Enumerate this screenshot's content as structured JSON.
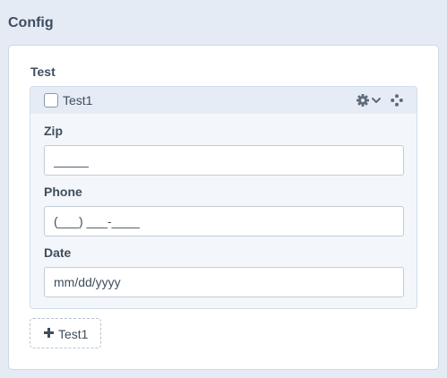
{
  "page": {
    "title": "Config"
  },
  "field": {
    "title": "Test",
    "block": {
      "label": "Test1",
      "checked": false,
      "icons": [
        "gear-icon",
        "chevron-down-icon",
        "move-icon"
      ],
      "fields": [
        {
          "label": "Zip",
          "value": "",
          "placeholder": "_____"
        },
        {
          "label": "Phone",
          "value": "",
          "placeholder": "(___) ___-____"
        },
        {
          "label": "Date",
          "value": "",
          "placeholder": "mm/dd/yyyy"
        }
      ]
    },
    "add_button_label": "Test1"
  },
  "colors": {
    "background": "#e4ebf4",
    "panel": "#ffffff",
    "block": "#f3f7fb",
    "block_header": "#e5ecf6",
    "text": "#3f4d5e"
  }
}
